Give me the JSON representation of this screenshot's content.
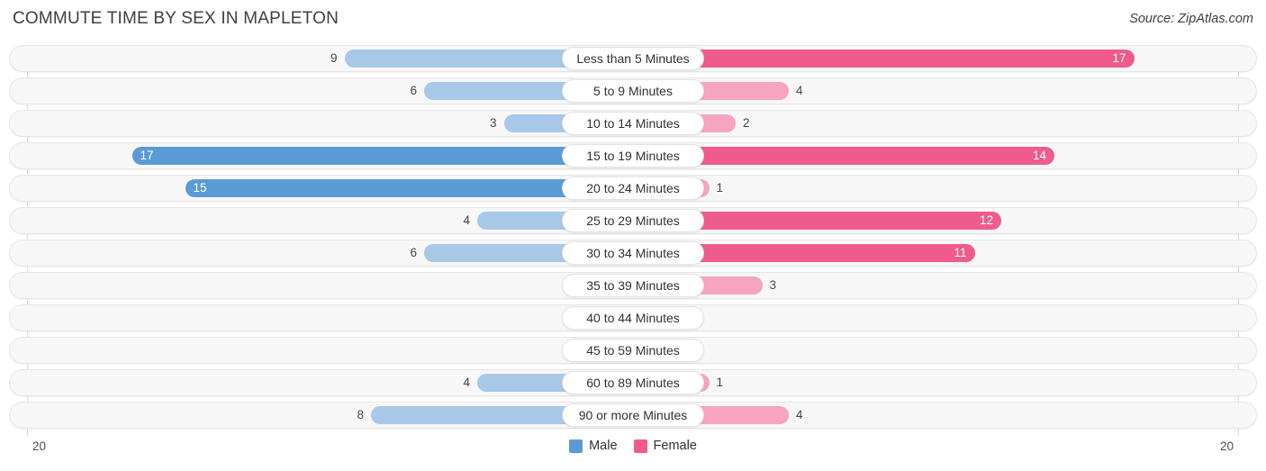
{
  "header": {
    "title": "COMMUTE TIME BY SEX IN MAPLETON",
    "source": "Source: ZipAtlas.com"
  },
  "axis": {
    "left_label": "20",
    "right_label": "20",
    "max": 20
  },
  "legend": {
    "items": [
      {
        "label": "Male",
        "color": "#5b9bd5"
      },
      {
        "label": "Female",
        "color": "#ef5b8c"
      }
    ]
  },
  "colors": {
    "male_strong": "#5b9bd5",
    "male_light": "#a8c8e8",
    "female_strong": "#ef5b8c",
    "female_light": "#f6a4c0",
    "track": "#f7f7f7",
    "track_border": "#e6e6e6",
    "grid": "#d9d9d9",
    "text": "#3c4043"
  },
  "chart_data": {
    "type": "bar",
    "title": "COMMUTE TIME BY SEX IN MAPLETON",
    "subtitle": "",
    "xlabel": "",
    "ylabel": "",
    "orientation": "horizontal-diverging",
    "grid": false,
    "legend_position": "bottom-center",
    "axis_max_each_side": 20,
    "xlim": [
      20,
      20
    ],
    "categories": [
      "Less than 5 Minutes",
      "5 to 9 Minutes",
      "10 to 14 Minutes",
      "15 to 19 Minutes",
      "20 to 24 Minutes",
      "25 to 29 Minutes",
      "30 to 34 Minutes",
      "35 to 39 Minutes",
      "40 to 44 Minutes",
      "45 to 59 Minutes",
      "60 to 89 Minutes",
      "90 or more Minutes"
    ],
    "series": [
      {
        "name": "Male",
        "values": [
          9,
          6,
          3,
          17,
          15,
          4,
          6,
          0,
          0,
          0,
          4,
          8
        ]
      },
      {
        "name": "Female",
        "values": [
          17,
          4,
          2,
          14,
          1,
          12,
          11,
          3,
          0,
          0,
          1,
          4
        ]
      }
    ]
  },
  "rows": [
    {
      "label": "Less than 5 Minutes",
      "male": "9",
      "female": "17"
    },
    {
      "label": "5 to 9 Minutes",
      "male": "6",
      "female": "4"
    },
    {
      "label": "10 to 14 Minutes",
      "male": "3",
      "female": "2"
    },
    {
      "label": "15 to 19 Minutes",
      "male": "17",
      "female": "14"
    },
    {
      "label": "20 to 24 Minutes",
      "male": "15",
      "female": "1"
    },
    {
      "label": "25 to 29 Minutes",
      "male": "4",
      "female": "12"
    },
    {
      "label": "30 to 34 Minutes",
      "male": "6",
      "female": "11"
    },
    {
      "label": "35 to 39 Minutes",
      "male": "0",
      "female": "3"
    },
    {
      "label": "40 to 44 Minutes",
      "male": "0",
      "female": "0"
    },
    {
      "label": "45 to 59 Minutes",
      "male": "0",
      "female": "0"
    },
    {
      "label": "60 to 89 Minutes",
      "male": "4",
      "female": "1"
    },
    {
      "label": "90 or more Minutes",
      "male": "8",
      "female": "4"
    }
  ]
}
